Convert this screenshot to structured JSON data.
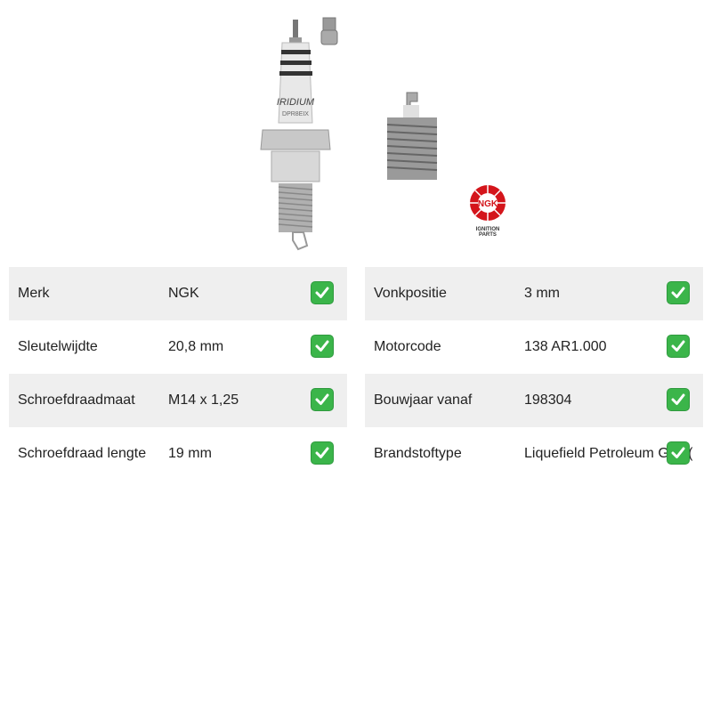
{
  "brand_logo": {
    "text": "NGK",
    "subtext": "IGNITION PARTS",
    "color": "#d4151b"
  },
  "left_table": [
    {
      "label": "Merk",
      "value": "NGK"
    },
    {
      "label": "Sleutelwijdte",
      "value": "20,8 mm"
    },
    {
      "label": "Schroefdraadmaat",
      "value": "M14 x 1,25"
    },
    {
      "label": "Schroefdraad lengte",
      "value": "19 mm"
    }
  ],
  "right_table": [
    {
      "label": "Vonkpositie",
      "value": "3 mm"
    },
    {
      "label": "Motorcode",
      "value": "138 AR1.000"
    },
    {
      "label": "Bouwjaar vanaf",
      "value": "198304"
    },
    {
      "label": "Brandstoftype",
      "value": "Liquefield Petroleum Gas ("
    }
  ],
  "product_image": {
    "print_text": "IRIDIUM",
    "model_text": "DPR8EIX"
  },
  "colors": {
    "check_green": "#3bb54a",
    "row_shade": "#efefef"
  }
}
